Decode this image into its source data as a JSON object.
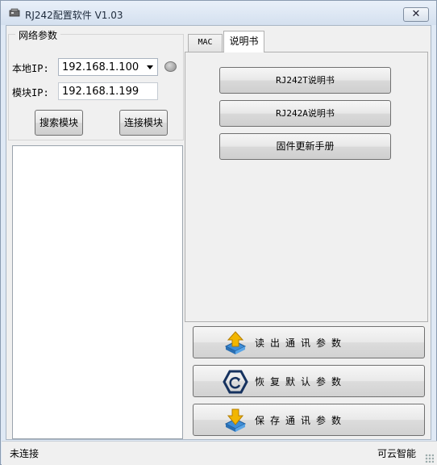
{
  "window": {
    "title": "RJ242配置软件 V1.03",
    "close_label": "✕",
    "icons": {
      "app": "device-icon",
      "close": "close-icon"
    }
  },
  "network": {
    "group_title": "网络参数",
    "local_ip_label": "本地IP:",
    "local_ip_value": "192.168.1.100",
    "module_ip_label": "模块IP:",
    "module_ip_value": "192.168.1.199",
    "search_button": "搜索模块",
    "connect_button": "连接模块"
  },
  "tabs": {
    "items": [
      "MAC",
      "说明书"
    ],
    "active": "说明书"
  },
  "manual": {
    "buttons": [
      "RJ242T说明书",
      "RJ242A说明书",
      "固件更新手册"
    ]
  },
  "actions": [
    {
      "label": "读出通讯参数",
      "icon": "read-params-icon"
    },
    {
      "label": "恢复默认参数",
      "icon": "restore-default-icon"
    },
    {
      "label": "保存通讯参数",
      "icon": "save-params-icon"
    }
  ],
  "status": {
    "left": "未连接",
    "right": "可云智能"
  },
  "colors": {
    "titlebar": "#dfe9f5",
    "arrow_yellow": "#f2b600",
    "restore_blue": "#16325f"
  }
}
